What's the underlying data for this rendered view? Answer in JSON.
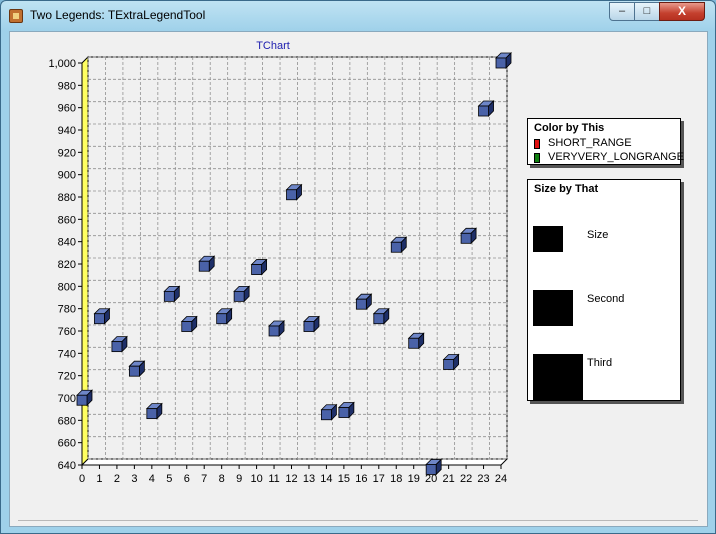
{
  "window": {
    "title": "Two Legends: TExtraLegendTool",
    "minimize_glyph": "–",
    "maximize_glyph": "□",
    "close_glyph": "X",
    "icon": "app-icon"
  },
  "colors": {
    "point_face": "#4a62a8",
    "point_top": "#6e86c8",
    "point_side": "#1e2f68",
    "wall": "#ffff60",
    "title": "#2020b0"
  },
  "chart_data": {
    "type": "scatter",
    "title": "TChart",
    "x": [
      0,
      1,
      2,
      3,
      4,
      5,
      6,
      7,
      8,
      9,
      10,
      11,
      12,
      13,
      14,
      15,
      16,
      17,
      18,
      19,
      20,
      21,
      22,
      23,
      24
    ],
    "y": [
      698,
      771,
      746,
      724,
      686,
      791,
      764,
      818,
      771,
      791,
      815,
      760,
      882,
      764,
      685,
      687,
      784,
      771,
      835,
      749,
      636,
      730,
      843,
      957,
      1000
    ],
    "xlim": [
      0,
      24
    ],
    "ylim": [
      640,
      1000
    ],
    "xticks": [
      "0",
      "1",
      "2",
      "3",
      "4",
      "5",
      "6",
      "7",
      "8",
      "9",
      "10",
      "11",
      "12",
      "13",
      "14",
      "15",
      "16",
      "17",
      "18",
      "19",
      "20",
      "21",
      "22",
      "23",
      "24"
    ],
    "yticks": [
      "640",
      "660",
      "680",
      "700",
      "720",
      "740",
      "760",
      "780",
      "800",
      "820",
      "840",
      "860",
      "880",
      "900",
      "920",
      "940",
      "960",
      "980",
      "1,000"
    ],
    "grid": true
  },
  "legend_color": {
    "title": "Color by This",
    "items": [
      {
        "label": "SHORT_RANGE",
        "color": "#e01010"
      },
      {
        "label": "VERYVERY_LONGRANGE",
        "color": "#108010"
      }
    ]
  },
  "legend_size": {
    "title": "Size by That",
    "items": [
      {
        "label": "Size"
      },
      {
        "label": "Second"
      },
      {
        "label": "Third"
      }
    ]
  }
}
